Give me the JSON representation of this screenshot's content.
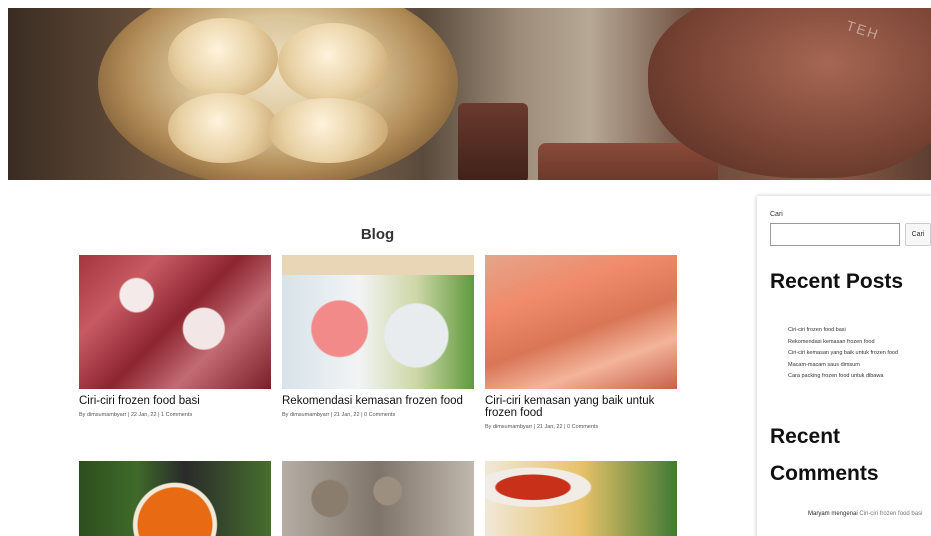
{
  "blog": {
    "heading": "Blog",
    "posts": [
      {
        "title": "Ciri-ciri frozen food basi",
        "meta": "By dimsumambyarr | 22 Jan, 22 | 1 Comments"
      },
      {
        "title": "Rekomendasi kemasan frozen food",
        "meta": "By dimsumambyarr | 21 Jan, 22 | 0 Comments"
      },
      {
        "title": "Ciri-ciri kemasan yang baik untuk frozen food",
        "meta": "By dimsumambyarr | 21 Jan, 22 | 0 Comments"
      },
      {
        "title": "",
        "meta": ""
      },
      {
        "title": "",
        "meta": ""
      },
      {
        "title": "",
        "meta": ""
      }
    ]
  },
  "hero": {
    "pot_label": "TEH"
  },
  "sidebar": {
    "search": {
      "label": "Cari",
      "button": "Cari",
      "value": ""
    },
    "recent_posts": {
      "heading": "Recent Posts",
      "items": [
        "Ciri-ciri frozen food basi",
        "Rekomendasi kemasan frozen food",
        "Ciri-ciri kemasan yang baik untuk frozen food",
        "Macam-macam saus dimsum",
        "Cara packing frozen food untuk dibawa"
      ]
    },
    "recent_comments": {
      "heading": "Recent Comments",
      "entries": [
        {
          "author": "Maryam",
          "joiner": "mengenai",
          "post": "Ciri-ciri frozen food basi"
        }
      ]
    }
  }
}
